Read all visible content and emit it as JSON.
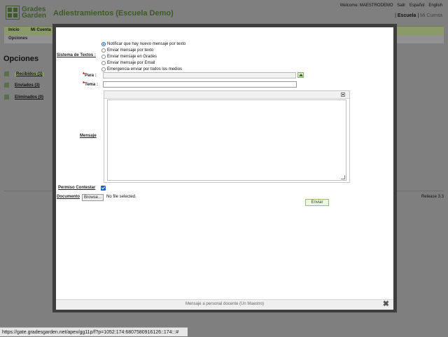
{
  "header": {
    "logo_text": [
      "Grades",
      "Garden"
    ],
    "app_title": "Adiestramientos (Escuela Demo)",
    "welcome": "Welcome: MAESTRODEMO",
    "links": [
      "Salir",
      "Español",
      "English"
    ],
    "school_bold": "Escuela",
    "school_separator": "|",
    "school_other": "Mi Cuenta"
  },
  "nav": {
    "items": [
      "Inicio",
      "Mi Cuenta"
    ],
    "sub": "Opciones"
  },
  "sidebar": {
    "title": "Opciones",
    "items": [
      {
        "label": "Recibidos (1)",
        "selected": true
      },
      {
        "label": "Enviados (3)",
        "selected": false
      },
      {
        "label": "Eliminados (0)",
        "selected": false
      }
    ]
  },
  "footer": {
    "release": "Release 3.3"
  },
  "modal": {
    "sistema_label": "Sistema de Textos :",
    "radio_options": [
      {
        "label": "Notificar que hay nuevo mensaje por texto",
        "checked": true
      },
      {
        "label": "Enviar mensaje por texto",
        "checked": false
      },
      {
        "label": "Enviar mensaje en Grades",
        "checked": false
      },
      {
        "label": "Enviar mensaje por Email",
        "checked": false
      },
      {
        "label": "Emergencia enviar por todos los medios",
        "checked": false
      }
    ],
    "para_label": "Para :",
    "tema_label": "Tema :",
    "required_mark": "*",
    "mensaje_label": "Mensaje",
    "permiso_label": "Permiso Contestar",
    "permiso_checked": true,
    "documento_label": "Documento",
    "browse_label": "Browse...",
    "no_file_text": "No file selected.",
    "send_label": "Enviar",
    "caption": "Mensaje a personal docente (Un Maestro)",
    "close_symbol": "✖"
  },
  "status_url": "https://gate.gradesgarden.net/apex/gg11p/f?p=1052:174:6807580916126::174:::#"
}
